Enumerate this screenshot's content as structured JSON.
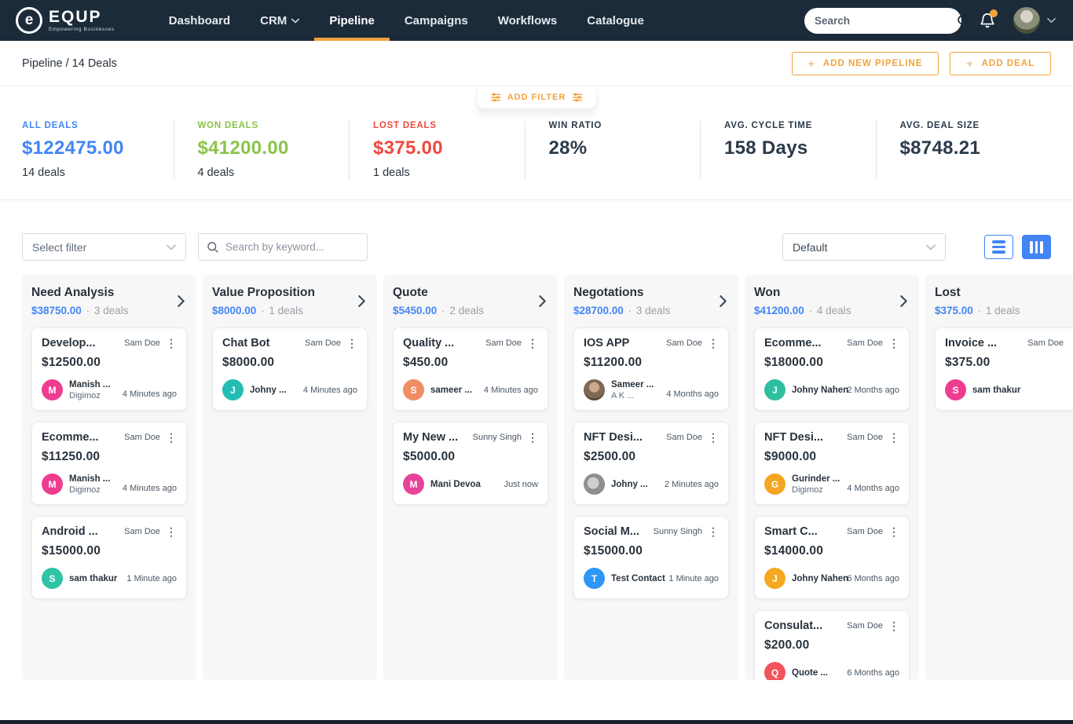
{
  "navbar": {
    "brand": "EQUP",
    "brand_initial": "e",
    "tagline": "Empowering Businesses",
    "items": [
      {
        "label": "Dashboard"
      },
      {
        "label": "CRM"
      },
      {
        "label": "Pipeline"
      },
      {
        "label": "Campaigns"
      },
      {
        "label": "Workflows"
      },
      {
        "label": "Catalogue"
      }
    ],
    "search_placeholder": "Search"
  },
  "subheader": {
    "breadcrumb": "Pipeline / 14 Deals",
    "plus": "+",
    "add_pipeline": "ADD NEW PIPELINE",
    "add_deal": "ADD DEAL",
    "add_filter": "ADD FILTER"
  },
  "stats": [
    {
      "label": "ALL DEALS",
      "value": "$122475.00",
      "sub": "14 deals",
      "color": "#4285F4"
    },
    {
      "label": "WON DEALS",
      "value": "$41200.00",
      "sub": "4 deals",
      "color": "#8BC34A"
    },
    {
      "label": "LOST DEALS",
      "value": "$375.00",
      "sub": "1 deals",
      "color": "#F0483E"
    },
    {
      "label": "WIN RATIO",
      "value": "28%",
      "color": "#2B3A4A"
    },
    {
      "label": "AVG. CYCLE TIME",
      "value": "158 Days",
      "color": "#2B3A4A"
    },
    {
      "label": "AVG. DEAL SIZE",
      "value": "$8748.21",
      "color": "#2B3A4A"
    }
  ],
  "toolbar": {
    "filter_placeholder": "Select filter",
    "search_placeholder": "Search by keyword...",
    "sort_value": "Default"
  },
  "board": {
    "separator": "·",
    "columns": [
      {
        "name": "Need Analysis",
        "amount": "$38750.00",
        "count": "3 deals",
        "cards": [
          {
            "title": "Develop...",
            "owner": "Sam Doe",
            "amount": "$12500.00",
            "avatar": "M",
            "avatar_color": "#EE3D8F",
            "contact": "Manish ...",
            "company": "Digimoz",
            "time": "4 Minutes ago"
          },
          {
            "title": "Ecomme...",
            "owner": "Sam Doe",
            "amount": "$11250.00",
            "avatar": "M",
            "avatar_color": "#EE3D8F",
            "contact": "Manish ...",
            "company": "Digimoz",
            "time": "4 Minutes ago"
          },
          {
            "title": "Android ...",
            "owner": "Sam Doe",
            "amount": "$15000.00",
            "avatar": "S",
            "avatar_color": "#2EC4A5",
            "contact": "sam thakur",
            "company": "",
            "time": "1 Minute ago"
          }
        ]
      },
      {
        "name": "Value Proposition",
        "amount": "$8000.00",
        "count": "1 deals",
        "cards": [
          {
            "title": "Chat Bot",
            "owner": "Sam Doe",
            "amount": "$8000.00",
            "avatar": "J",
            "avatar_color": "#22BDB2",
            "contact": "Johny ...",
            "company": "",
            "time": "4 Minutes ago"
          }
        ]
      },
      {
        "name": "Quote",
        "amount": "$5450.00",
        "count": "2 deals",
        "cards": [
          {
            "title": "Quality ...",
            "owner": "Sam Doe",
            "amount": "$450.00",
            "avatar": "S",
            "avatar_color": "#F08E63",
            "contact": "sameer ...",
            "company": "",
            "time": "4 Minutes ago"
          },
          {
            "title": "My New ...",
            "owner": "Sunny Singh",
            "amount": "$5000.00",
            "avatar": "M",
            "avatar_color": "#E8429B",
            "contact": "Mani Devoa",
            "company": "",
            "time": "Just now"
          }
        ]
      },
      {
        "name": "Negotations",
        "amount": "$28700.00",
        "count": "3 deals",
        "cards": [
          {
            "title": "IOS APP",
            "owner": "Sam Doe",
            "amount": "$11200.00",
            "avatar": "",
            "avatar_color": "",
            "contact": "Sameer ...",
            "company": "A K ...",
            "time": "4 Months ago"
          },
          {
            "title": "NFT Desi...",
            "owner": "Sam Doe",
            "amount": "$2500.00",
            "avatar": "",
            "avatar_color": "",
            "contact": "Johny ...",
            "company": "",
            "time": "2 Minutes ago"
          },
          {
            "title": "Social M...",
            "owner": "Sunny Singh",
            "amount": "$15000.00",
            "avatar": "T",
            "avatar_color": "#2E96F5",
            "contact": "Test Contact",
            "company": "",
            "time": "1 Minute ago"
          }
        ]
      },
      {
        "name": "Won",
        "amount": "$41200.00",
        "count": "4 deals",
        "cards": [
          {
            "title": "Ecomme...",
            "owner": "Sam Doe",
            "amount": "$18000.00",
            "avatar": "J",
            "avatar_color": "#2DBFA0",
            "contact": "Johny Nahen",
            "company": "",
            "time": "2 Months ago"
          },
          {
            "title": "NFT Desi...",
            "owner": "Sam Doe",
            "amount": "$9000.00",
            "avatar": "G",
            "avatar_color": "#F5A623",
            "contact": "Gurinder ...",
            "company": "Digimoz",
            "time": "4 Months ago"
          },
          {
            "title": "Smart C...",
            "owner": "Sam Doe",
            "amount": "$14000.00",
            "avatar": "J",
            "avatar_color": "#F5A81F",
            "contact": "Johny Nahen",
            "company": "",
            "time": "6 Months ago"
          },
          {
            "title": "Consulat...",
            "owner": "Sam Doe",
            "amount": "$200.00",
            "avatar": "Q",
            "avatar_color": "#F2545B",
            "contact": "Quote ...",
            "company": "",
            "time": "6 Months ago"
          }
        ]
      },
      {
        "name": "Lost",
        "amount": "$375.00",
        "count": "1 deals",
        "cards": [
          {
            "title": "Invoice ...",
            "owner": "Sam Doe",
            "amount": "$375.00",
            "avatar": "S",
            "avatar_color": "#EE3D8F",
            "contact": "sam thakur",
            "company": "",
            "time": ""
          }
        ]
      }
    ]
  }
}
